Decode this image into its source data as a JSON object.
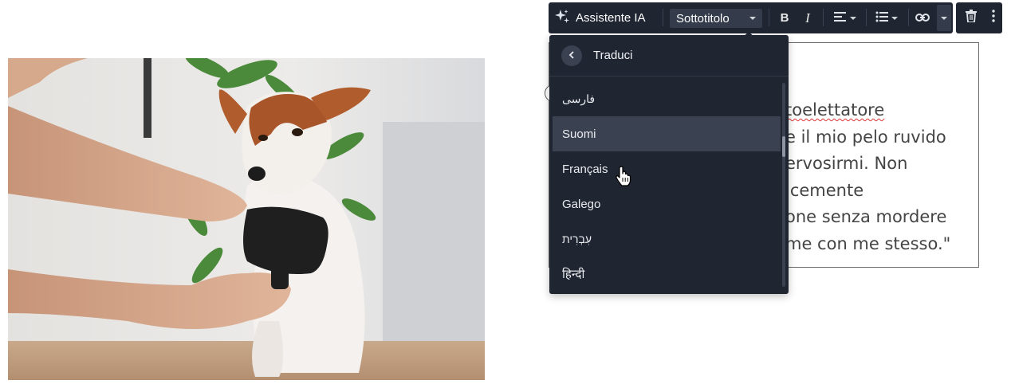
{
  "toolbar": {
    "ai_label": "Assistente IA",
    "style_select": "Sottotitolo",
    "bold": "B",
    "italic": "I"
  },
  "menu": {
    "title": "Traduci",
    "items": [
      {
        "label": "فارسی"
      },
      {
        "label": "Suomi"
      },
      {
        "label": "Français"
      },
      {
        "label": "Galego"
      },
      {
        "label": "עִבְרִית"
      },
      {
        "label": "हिन्दी"
      }
    ]
  },
  "text_block": {
    "lines": [
      "toelettatore",
      "e il mio pelo ruvido",
      "ervosirmi. Non",
      "icemente",
      "one senza mordere",
      "me con me stesso.\""
    ]
  },
  "colors": {
    "toolbar_bg": "#1f2531",
    "menu_hover": "#3a4252",
    "text": "#444444"
  },
  "icons": [
    "sparkle-icon",
    "align-left-icon",
    "list-icon",
    "link-icon",
    "trash-icon",
    "more-vertical-icon",
    "chevron-left-icon",
    "hand-cursor-icon"
  ]
}
